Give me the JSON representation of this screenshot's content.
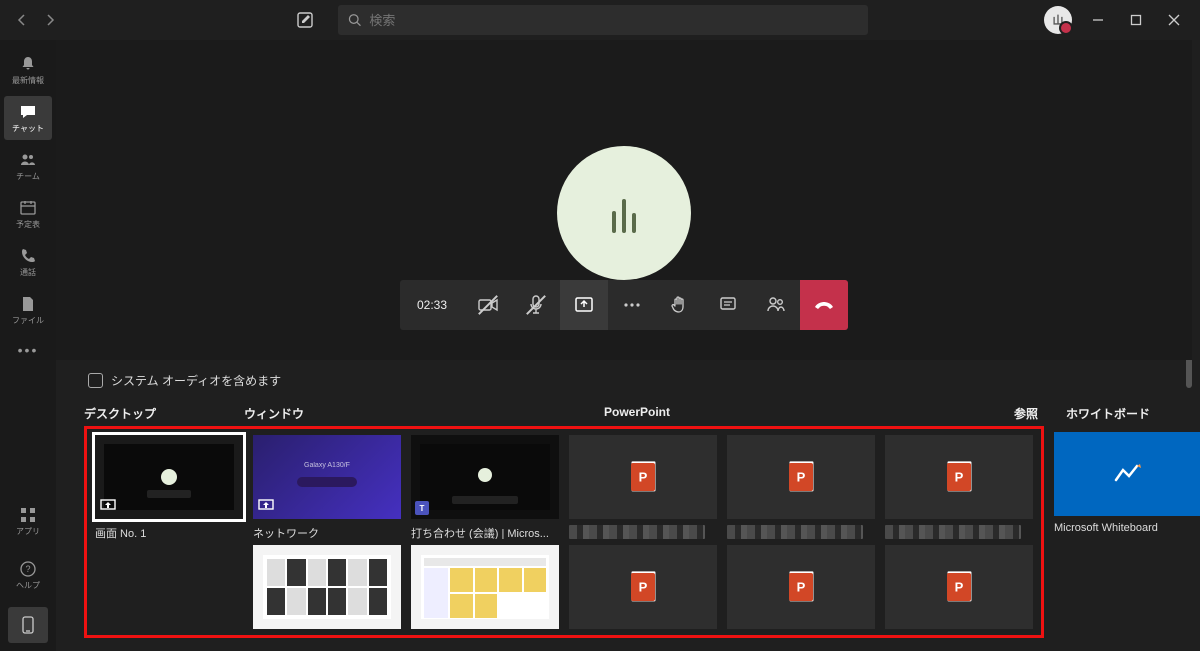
{
  "search": {
    "placeholder": "検索"
  },
  "rail": {
    "items": [
      {
        "label": "最新情報",
        "name": "activity"
      },
      {
        "label": "チャット",
        "name": "chat"
      },
      {
        "label": "チーム",
        "name": "teams"
      },
      {
        "label": "予定表",
        "name": "calendar"
      },
      {
        "label": "通話",
        "name": "calls"
      },
      {
        "label": "ファイル",
        "name": "files"
      }
    ],
    "apps": "アプリ",
    "help": "ヘルプ"
  },
  "call": {
    "timer": "02:33"
  },
  "share": {
    "audioCheckbox": "システム オーディオを含めます",
    "desktopLabel": "デスクトップ",
    "windowLabel": "ウィンドウ",
    "powerpointLabel": "PowerPoint",
    "browseLabel": "参照",
    "whiteboardLabel": "ホワイトボード",
    "thumbs": {
      "screen1": "画面 No. 1",
      "network": "ネットワーク",
      "meeting": "打ち合わせ (会議) | Micros...",
      "whiteboard": "Microsoft Whiteboard",
      "galaxy": "Galaxy A130/F"
    }
  }
}
